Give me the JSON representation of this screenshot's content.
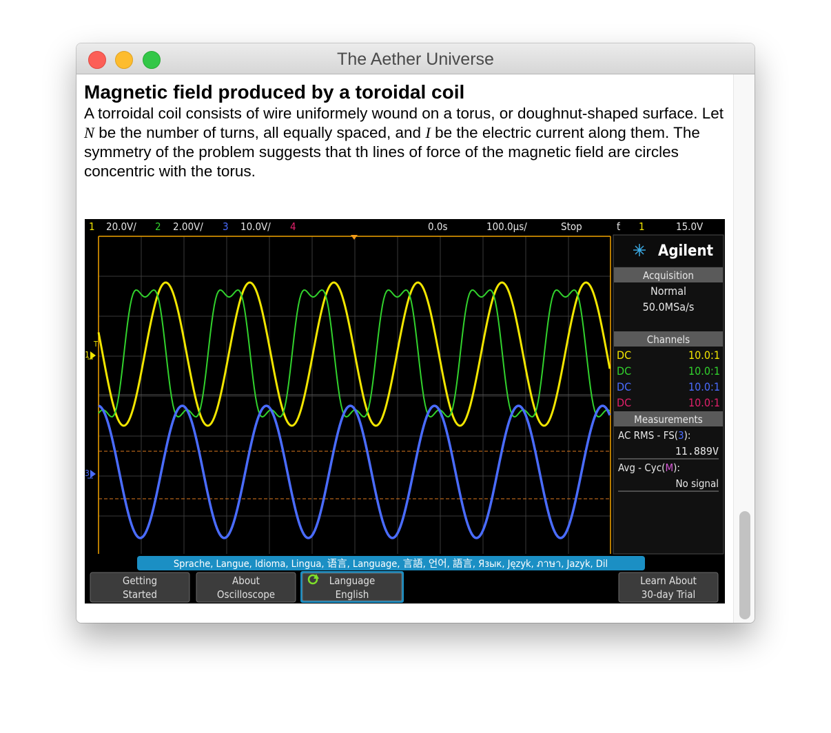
{
  "window": {
    "title": "The Aether Universe"
  },
  "article": {
    "heading": "Magnetic field produced by a toroidal coil",
    "p1": "A torroidal coil consists of wire uniformely wound on a torus, or doughnut-shaped surface. Let ",
    "var_n": "N",
    "p2": " be the number of turns, all equally spaced, and ",
    "var_i": "I",
    "p3": " be the electric current along them. The symmetry of the problem suggests that th lines of force of the magnetic field are circles concentric with the torus."
  },
  "scope": {
    "topbar": {
      "ch1_num": "1",
      "ch1_scale": "20.0V/",
      "ch2_num": "2",
      "ch2_scale": "2.00V/",
      "ch3_num": "3",
      "ch3_scale": "10.0V/",
      "ch4_num": "4",
      "time": "0.0s",
      "timebase": "100.0μs/",
      "run_state": "Stop",
      "trig_icon": "ƭ",
      "trig_ch": "1",
      "trig_level": "15.0V"
    },
    "brand": "Agilent",
    "acquisition": {
      "title": "Acquisition",
      "mode": "Normal",
      "rate": "50.0MSa/s"
    },
    "channels": {
      "title": "Channels",
      "rows": [
        {
          "coupling": "DC",
          "ratio": "10.0:1",
          "color": "#f2e600"
        },
        {
          "coupling": "DC",
          "ratio": "10.0:1",
          "color": "#32d22d"
        },
        {
          "coupling": "DC",
          "ratio": "10.0:1",
          "color": "#4a6cff"
        },
        {
          "coupling": "DC",
          "ratio": "10.0:1",
          "color": "#e0206a"
        }
      ]
    },
    "measurements": {
      "title": "Measurements",
      "m1_label_a": "AC RMS - FS(",
      "m1_label_ch": "3",
      "m1_label_b": "):",
      "m1_value": "11.889V",
      "m2_label_a": "Avg - Cyc(",
      "m2_label_ch": "M",
      "m2_label_b": "):",
      "m2_value": "No signal"
    },
    "language_bar": "Sprache, Langue, Idioma, Lingua, 语言, Language, 言語, 언어, 語言, Язык, Język, ภาษา, Jazyk, Dil",
    "softkeys": [
      {
        "line1": "Getting",
        "line2": "Started"
      },
      {
        "line1": "About",
        "line2": "Oscilloscope"
      },
      {
        "line1": "Language",
        "line2": "English"
      },
      {
        "line1": "Learn About",
        "line2": "30-day Trial"
      }
    ],
    "ground_markers": {
      "ch1": "1",
      "ch3": "3"
    },
    "trigger_marker": "T",
    "colors": {
      "ch1": "#f2e600",
      "ch2": "#32d22d",
      "ch3": "#4a6cff",
      "ch4": "#e0206a",
      "accent": "#1b8fc4"
    }
  }
}
